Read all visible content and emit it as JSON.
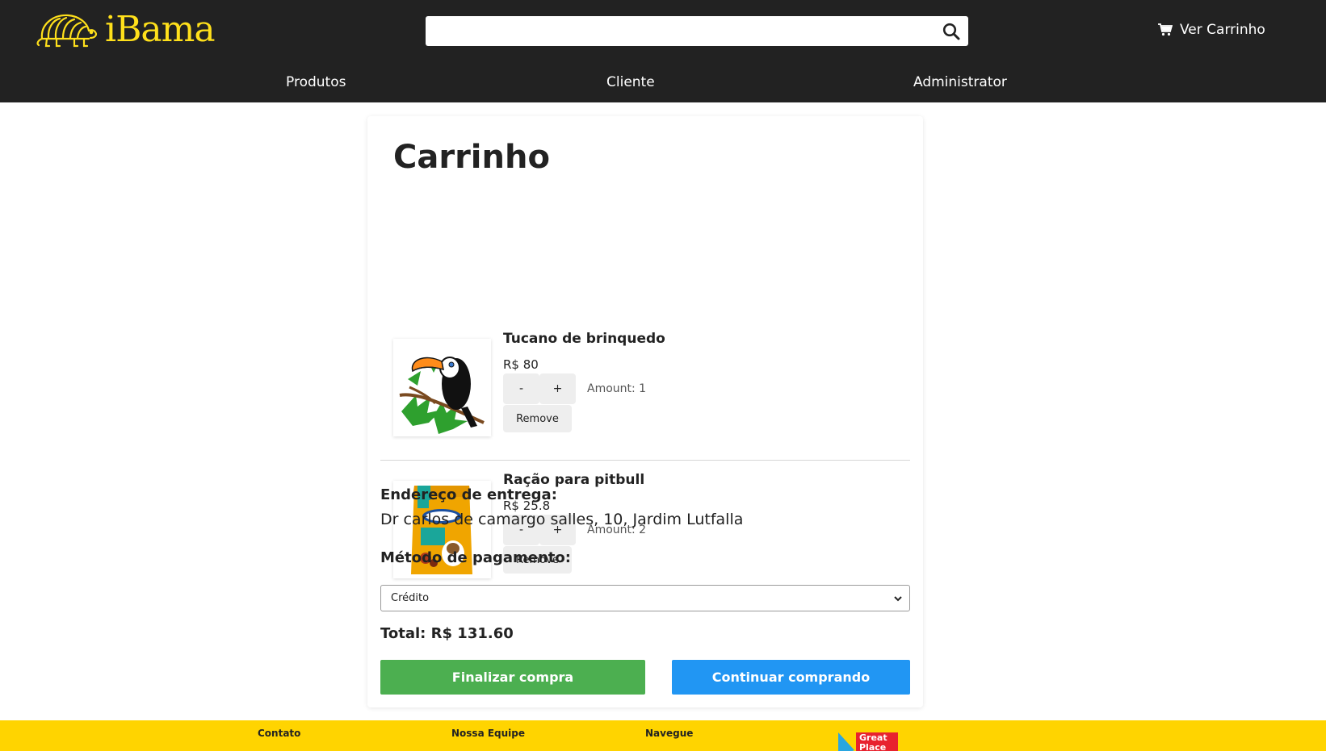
{
  "header": {
    "logo_text": "iBama",
    "search": {
      "value": "",
      "placeholder": ""
    },
    "cart_label": "Ver Carrinho",
    "nav": [
      "Produtos",
      "Cliente",
      "Administrator"
    ],
    "colors": {
      "bar": "#222222",
      "brand": "#ffe01b"
    },
    "icons": [
      "armadillo-logo",
      "search-icon",
      "cart-icon"
    ]
  },
  "cart": {
    "title": "Carrinho",
    "items": [
      {
        "name": "Tucano de brinquedo",
        "price": "R$ 80",
        "minus": "-",
        "plus": "+",
        "amount": "Amount: 1",
        "remove": "Remove",
        "image": "toucan-toy"
      },
      {
        "name": "Ração para pitbull",
        "price": "R$ 25.8",
        "minus": "-",
        "plus": "+",
        "amount": "Amount: 2",
        "remove": "Remove",
        "image": "pedigree-dog-food-bag"
      }
    ],
    "address_label": "Endereço de entrega:",
    "address_value": "Dr carlos de camargo salles, 10, Jardim Lutfalla",
    "payment_label": "Método de pagamento:",
    "payment_selected": "Crédito",
    "total": "Total: R$ 131.60",
    "finish_button": "Finalizar compra",
    "continue_button": "Continuar comprando",
    "colors": {
      "finish": "#4caf50",
      "continue": "#2196f3"
    }
  },
  "footer": {
    "headings": [
      "Contato",
      "Nossa Equipe",
      "Navegue"
    ],
    "badge_text": [
      "Great",
      "Place"
    ],
    "colors": {
      "background": "#ffd400",
      "badge": "#e8222e"
    }
  }
}
